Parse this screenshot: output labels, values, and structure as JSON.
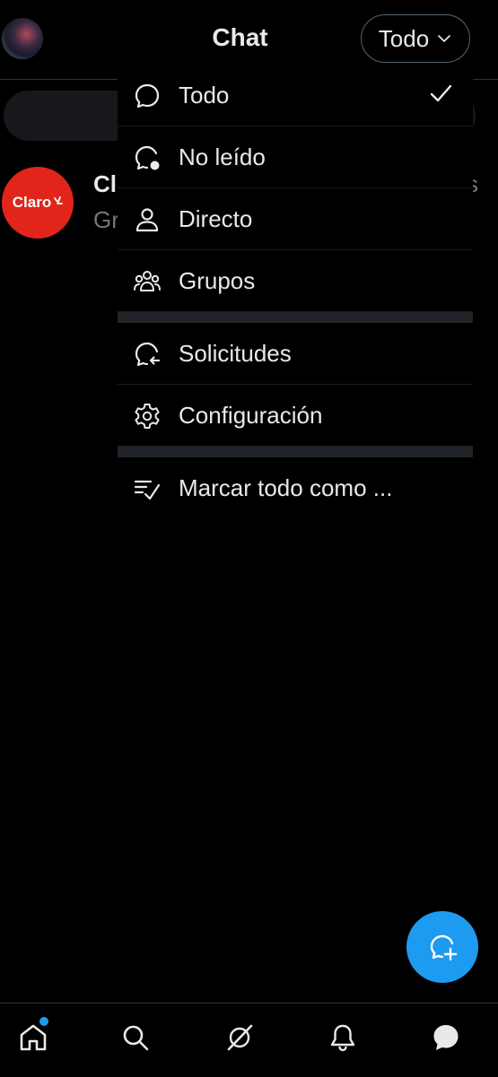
{
  "header": {
    "title": "Chat",
    "filter_label": "Todo"
  },
  "conversation": {
    "logo_text": "Claro",
    "name_partial": "Cl",
    "preview_partial": "Gr",
    "time_partial": "s"
  },
  "menu": {
    "items": [
      {
        "label": "Todo",
        "icon": "chat-bubble-icon",
        "selected": true
      },
      {
        "label": "No leído",
        "icon": "unread-bubble-icon"
      },
      {
        "label": "Directo",
        "icon": "person-icon"
      },
      {
        "label": "Grupos",
        "icon": "group-icon"
      },
      {
        "label": "Solicitudes",
        "icon": "requests-icon"
      },
      {
        "label": "Configuración",
        "icon": "gear-icon"
      },
      {
        "label": "Marcar todo como ...",
        "icon": "mark-read-icon"
      }
    ]
  },
  "bottom_nav": [
    {
      "icon": "home-icon",
      "badge": true
    },
    {
      "icon": "search-icon"
    },
    {
      "icon": "grok-icon"
    },
    {
      "icon": "bell-icon"
    },
    {
      "icon": "messages-icon",
      "active": true
    }
  ],
  "colors": {
    "accent": "#1d9bf0",
    "brand_claro": "#e1251b",
    "background": "#000000"
  }
}
